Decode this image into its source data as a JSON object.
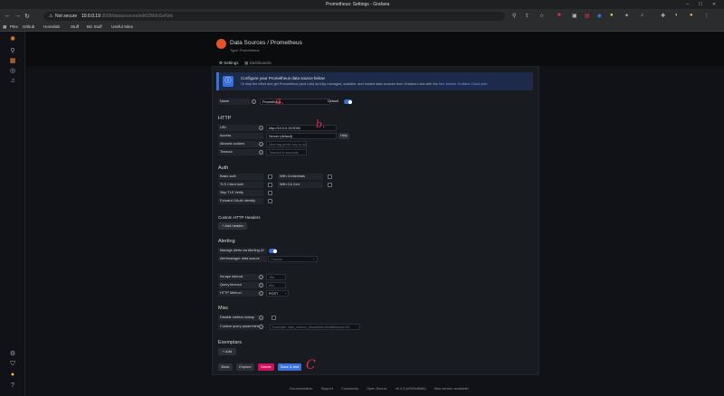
{
  "browser": {
    "window_title": "Prometheus: Settings - Grafana",
    "security_label": "Not secure",
    "url_host": "10.0.0.19",
    "url_rest": ":3000/datasources/edit/ZMdcGeNnk",
    "bookmarks": [
      "Plex",
      "Github",
      "Homelab",
      "Stuff",
      "Biz Stuff",
      "Useful Sites"
    ]
  },
  "page": {
    "breadcrumb_parent": "Data Sources",
    "breadcrumb_sep": " / ",
    "breadcrumb_current": "Prometheus",
    "subtitle": "Type: Prometheus",
    "tabs": [
      {
        "label": "Settings",
        "active": true
      },
      {
        "label": "Dashboards",
        "active": false
      }
    ]
  },
  "banner": {
    "title": "Configure your Prometheus data source below",
    "text": "Or skip the effort and get Prometheus (and Loki) as fully-managed, scalable, and hosted data sources from Grafana Labs with the ",
    "link": "free-forever Grafana Cloud plan."
  },
  "name_row": {
    "label": "Name",
    "value": "Prometheus",
    "default_label": "Default",
    "default_on": true
  },
  "http": {
    "title": "HTTP",
    "url_label": "URL",
    "url_value": "http://10.0.0.19:9090",
    "access_label": "Access",
    "access_value": "Server (default)",
    "help_label": "Help",
    "allowed_cookies_label": "Allowed cookies",
    "allowed_cookies_placeholder": "New tag (enter key to add)",
    "timeout_label": "Timeout",
    "timeout_placeholder": "Timeout in seconds"
  },
  "auth": {
    "title": "Auth",
    "basic_auth": "Basic auth",
    "tls_client_auth": "TLS Client Auth",
    "skip_tls_verify": "Skip TLS Verify",
    "forward_oauth": "Forward OAuth Identity",
    "with_credentials": "With Credentials",
    "with_ca_cert": "With CA Cert"
  },
  "custom_headers": {
    "title": "Custom HTTP Headers",
    "add_button": "+ Add header"
  },
  "alerting": {
    "title": "Alerting",
    "manage_alerts_label": "Manage alerts via Alerting UI",
    "manage_alerts_on": true,
    "alertmanager_label": "Alertmanager data source",
    "alertmanager_placeholder": "Choose"
  },
  "prom": {
    "scrape_interval_label": "Scrape interval",
    "scrape_interval_ph": "15s",
    "query_timeout_label": "Query timeout",
    "query_timeout_ph": "60s",
    "http_method_label": "HTTP Method",
    "http_method_value": "POST"
  },
  "misc": {
    "title": "Misc",
    "disable_metrics_lookup": "Disable metrics lookup",
    "custom_query_params": "Custom query parameters",
    "custom_query_placeholder": "Example: max_source_resolution=5m&timeout=10"
  },
  "exemplars": {
    "title": "Exemplars",
    "add_button": "+ Add"
  },
  "actions": {
    "back": "Back",
    "explore": "Explore",
    "delete": "Delete",
    "save_test": "Save & test"
  },
  "annotations": {
    "a": "a.",
    "b": "b.",
    "c": "C"
  },
  "footer": [
    "Documentation",
    "Support",
    "Community",
    "Open Source",
    "v8.4.3 (a992b4fb8b)",
    "New version available!"
  ],
  "colors": {
    "accent": "#3871dc",
    "danger": "#d10e5c",
    "brand": "#e6522c",
    "annotation": "#e02f44"
  }
}
